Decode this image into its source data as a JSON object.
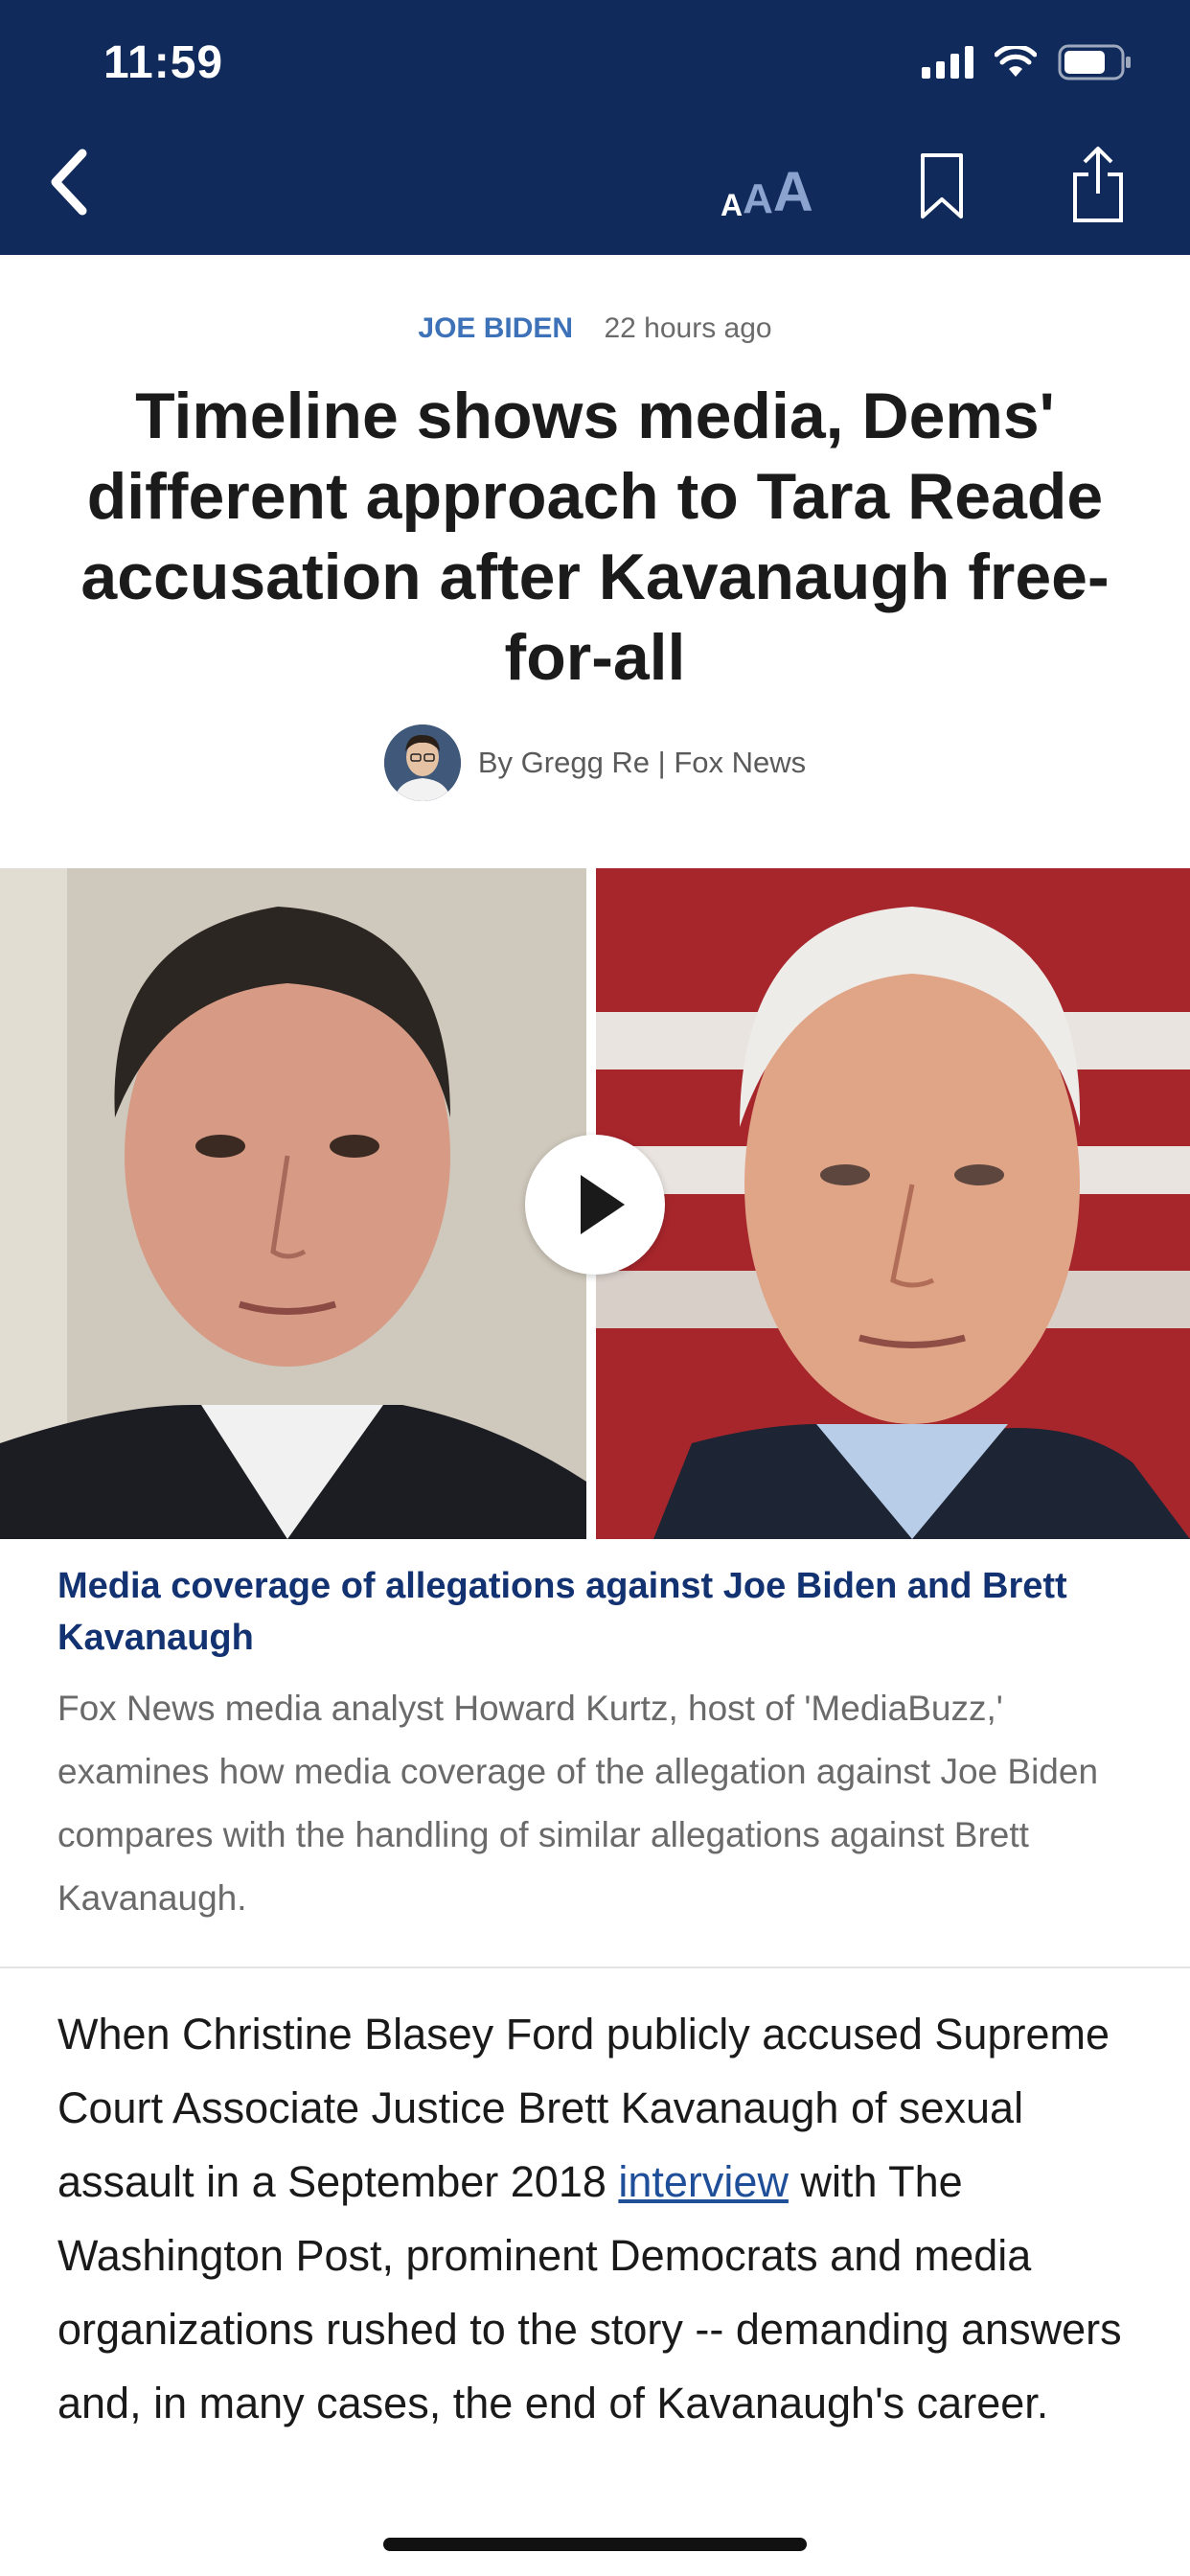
{
  "status_bar": {
    "time": "11:59"
  },
  "nav": {
    "back_icon": "chevron-left-icon",
    "text_size_icon": "text-size-icon",
    "text_size_glyphs": [
      "A",
      "A",
      "A"
    ],
    "bookmark_icon": "bookmark-icon",
    "share_icon": "share-icon"
  },
  "article": {
    "category": "JOE BIDEN",
    "timestamp": "22 hours ago",
    "headline": "Timeline shows media, Dems' different approach to Tara Reade accusation after Kavanaugh free-for-all",
    "byline": "By Gregg Re | Fox News"
  },
  "video": {
    "play_icon": "play-icon",
    "caption_title": "Media coverage of allegations against Joe Biden and Brett Kavanaugh",
    "caption_desc": "Fox News media analyst Howard Kurtz, host of 'MediaBuzz,' examines how media coverage of the allegation against Joe Biden compares with the handling of similar allegations against Brett Kavanaugh."
  },
  "body": {
    "paragraph_before_link": "When Christine Blasey Ford publicly accused Supreme Court Associate Justice Brett Kavanaugh of sexual assault in a September 2018 ",
    "link_text": "interview",
    "paragraph_after_link": " with The Washington Post, prominent Democrats and media organizations rushed to the story -- demanding answers and, in many cases, the end of Kavanaugh's career."
  },
  "colors": {
    "header_bg": "#102a5c",
    "category": "#3d72b8",
    "caption_title": "#133271",
    "link": "#1f4f99"
  }
}
